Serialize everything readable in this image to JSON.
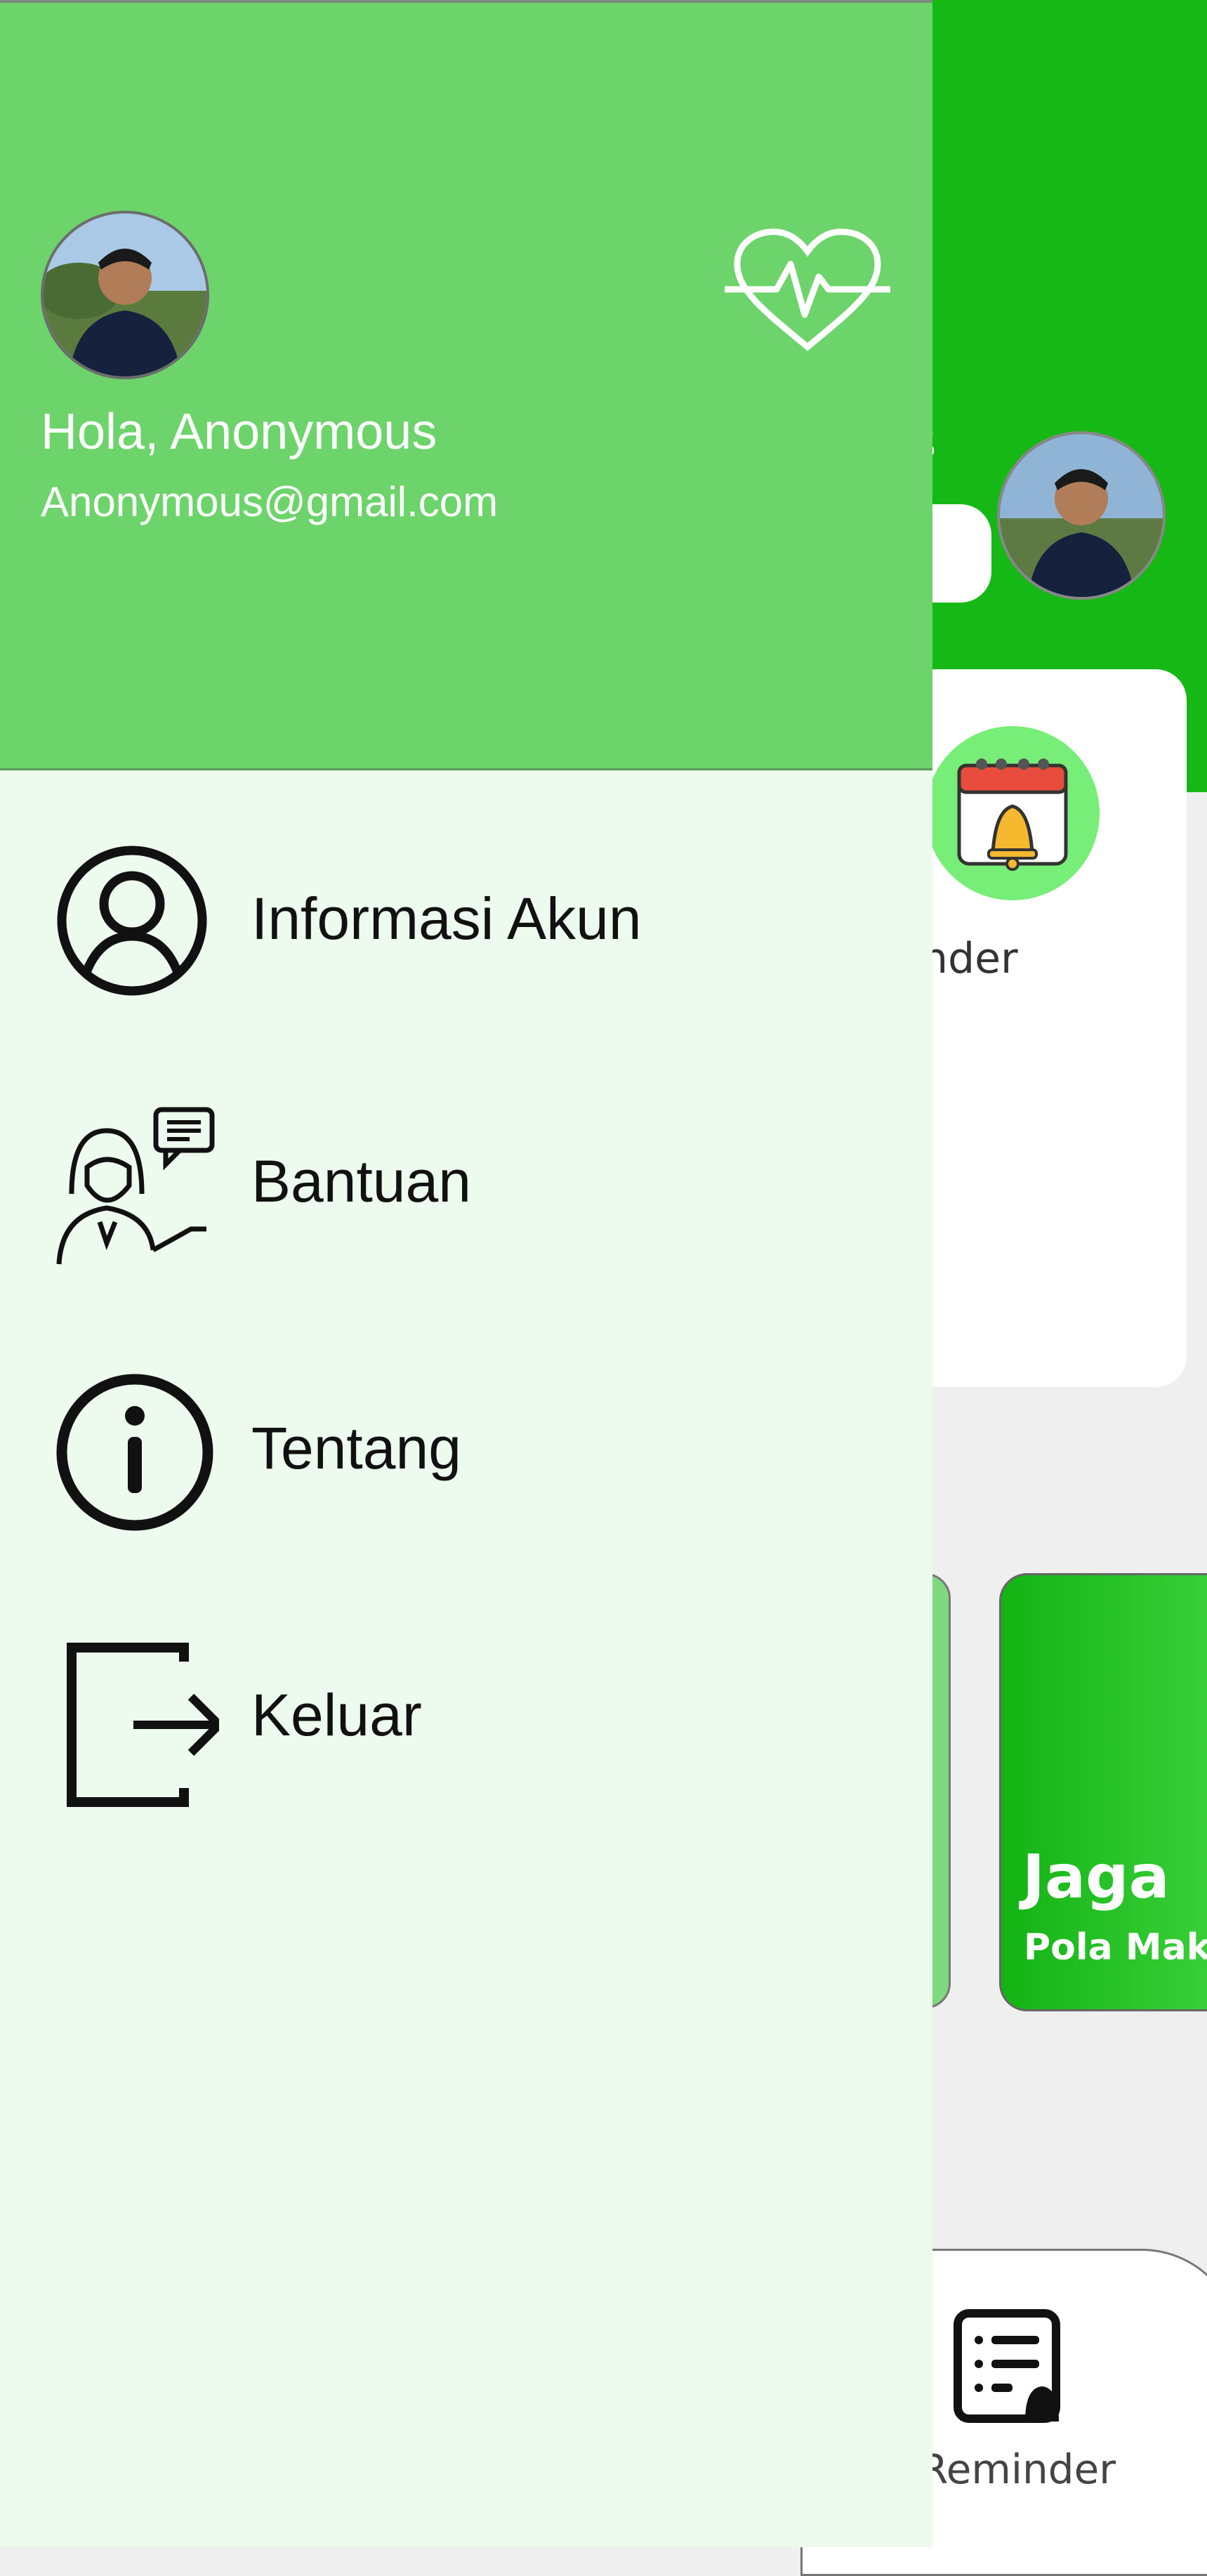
{
  "background": {
    "greeting_fragment": "us",
    "reminder_label": "eminder",
    "promo": {
      "title": "Jaga",
      "subtitle": "Pola Maka"
    },
    "bottom_nav_label": "Reminder"
  },
  "drawer": {
    "greeting": "Hola, Anonymous",
    "email": "Anonymous@gmail.com",
    "menu": [
      {
        "label": "Informasi Akun",
        "icon": "user-circle-icon"
      },
      {
        "label": "Bantuan",
        "icon": "support-agent-icon"
      },
      {
        "label": "Tentang",
        "icon": "info-icon"
      },
      {
        "label": "Keluar",
        "icon": "logout-icon"
      }
    ]
  },
  "colors": {
    "header_green": "#16b816",
    "drawer_header": "#6cd46a",
    "drawer_body": "#edfaee"
  }
}
